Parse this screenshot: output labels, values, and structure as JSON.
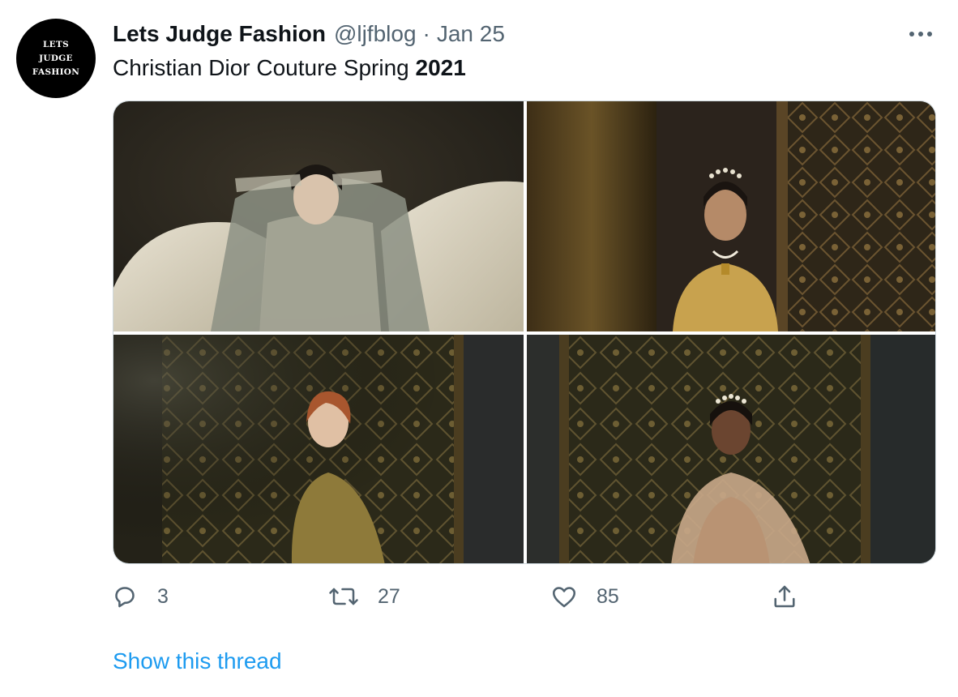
{
  "author": {
    "display_name": "Lets Judge Fashion",
    "handle": "@ljfblog",
    "separator": "·",
    "date": "Jan 25",
    "avatar_logo": [
      "LETS",
      "JUDGE",
      "FASHION"
    ]
  },
  "tweet": {
    "text_plain": "Christian Dior Couture Spring ",
    "text_bold": "2021"
  },
  "media": {
    "photo_count": 4
  },
  "actions": {
    "reply_count": "3",
    "retweet_count": "27",
    "like_count": "85"
  },
  "icons": {
    "more": "more-horizontal-icon",
    "reply": "reply-bubble-icon",
    "retweet": "retweet-icon",
    "like": "heart-icon",
    "share": "share-upload-icon"
  },
  "colors": {
    "text_primary": "#0f1419",
    "text_secondary": "#536471",
    "link": "#1d9bf0",
    "border": "#cfd9de"
  },
  "thread": {
    "show_label": "Show this thread"
  }
}
